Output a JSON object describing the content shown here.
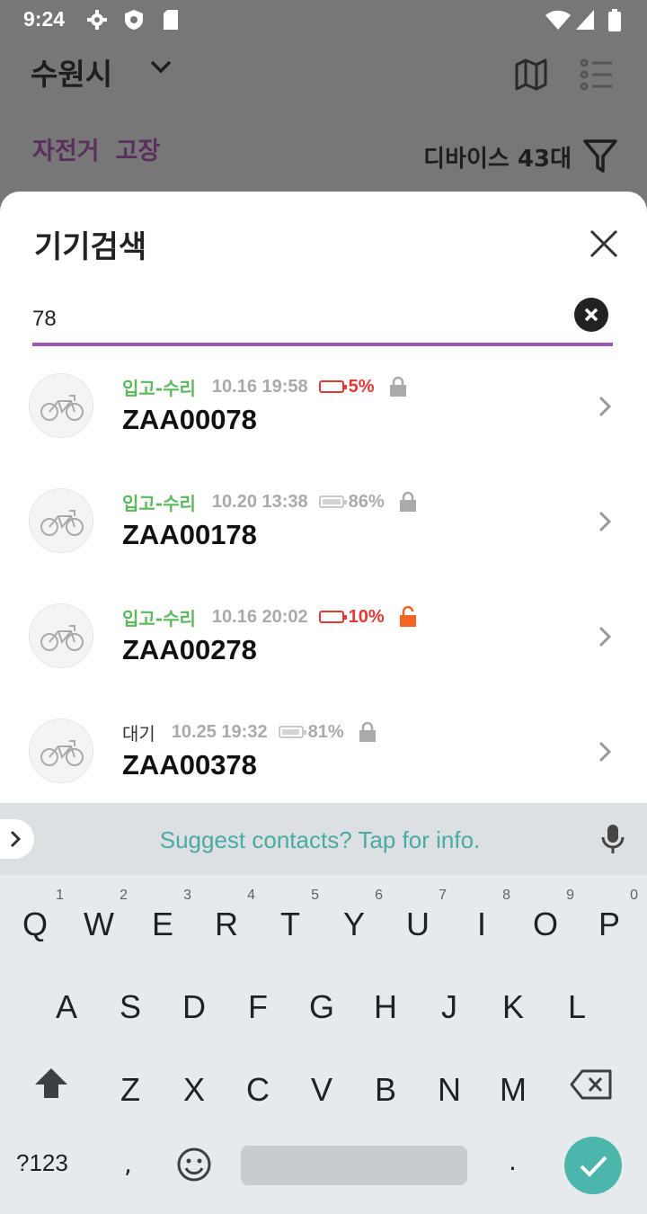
{
  "status_bar": {
    "time": "9:24"
  },
  "header": {
    "city": "수원시"
  },
  "tabs": [
    {
      "label": "자전거"
    },
    {
      "label": "고장"
    }
  ],
  "device_count": "디바이스 43대",
  "sheet": {
    "title": "기기검색",
    "search_value": "78"
  },
  "devices": [
    {
      "status": "입고-수리",
      "timestamp": "10.16 19:58",
      "battery": "5%",
      "battery_level": 0.05,
      "battery_low": true,
      "lock": "locked-gray",
      "id": "ZAA00078"
    },
    {
      "status": "입고-수리",
      "timestamp": "10.20 13:38",
      "battery": "86%",
      "battery_level": 0.86,
      "battery_low": false,
      "lock": "locked-gray",
      "id": "ZAA00178"
    },
    {
      "status": "입고-수리",
      "timestamp": "10.16 20:02",
      "battery": "10%",
      "battery_level": 0.1,
      "battery_low": true,
      "lock": "unlocked-orange",
      "id": "ZAA00278"
    },
    {
      "status": "대기",
      "timestamp": "10.25 19:32",
      "battery": "81%",
      "battery_level": 0.81,
      "battery_low": false,
      "lock": "locked-gray",
      "id": "ZAA00378"
    }
  ],
  "keyboard": {
    "suggestion": "Suggest contacts? Tap for info.",
    "row1": [
      "Q",
      "W",
      "E",
      "R",
      "T",
      "Y",
      "U",
      "I",
      "O",
      "P"
    ],
    "row1_hints": [
      "1",
      "2",
      "3",
      "4",
      "5",
      "6",
      "7",
      "8",
      "9",
      "0"
    ],
    "row2": [
      "A",
      "S",
      "D",
      "F",
      "G",
      "H",
      "J",
      "K",
      "L"
    ],
    "row3": [
      "Z",
      "X",
      "C",
      "V",
      "B",
      "N",
      "M"
    ],
    "symbols_label": "?123",
    "comma": ",",
    "period": "."
  },
  "colors": {
    "accent": "#9b59b6",
    "status_green": "#5cb85c",
    "battery_low": "#e53935",
    "unlocked": "#f26522",
    "enter": "#4db6ac"
  }
}
